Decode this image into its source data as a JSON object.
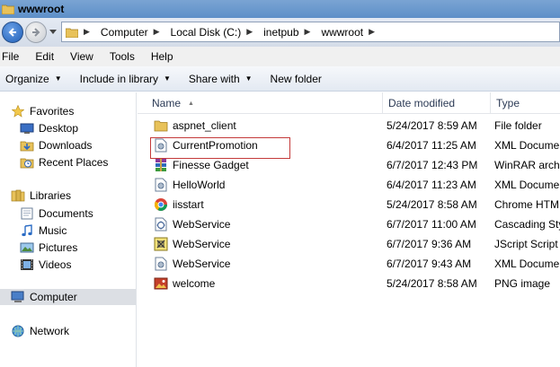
{
  "window": {
    "title": "wwwroot"
  },
  "address": {
    "crumbs": [
      {
        "label": "Computer"
      },
      {
        "label": "Local Disk (C:)"
      },
      {
        "label": "inetpub"
      },
      {
        "label": "wwwroot"
      }
    ]
  },
  "menu": {
    "items": [
      "File",
      "Edit",
      "View",
      "Tools",
      "Help"
    ]
  },
  "commands": {
    "organize": "Organize",
    "include": "Include in library",
    "share": "Share with",
    "newfolder": "New folder"
  },
  "navpane": {
    "favorites": "Favorites",
    "desktop": "Desktop",
    "downloads": "Downloads",
    "recent": "Recent Places",
    "libraries": "Libraries",
    "documents": "Documents",
    "music": "Music",
    "pictures": "Pictures",
    "videos": "Videos",
    "computer": "Computer",
    "network": "Network"
  },
  "columns": {
    "name": "Name",
    "date": "Date modified",
    "type": "Type"
  },
  "files": [
    {
      "name": "aspnet_client",
      "date": "5/24/2017 8:59 AM",
      "type": "File folder",
      "icon": "folder-icon"
    },
    {
      "name": "CurrentPromotion",
      "date": "6/4/2017 11:25 AM",
      "type": "XML Document",
      "icon": "xml-file-icon"
    },
    {
      "name": "Finesse Gadget",
      "date": "6/7/2017 12:43 PM",
      "type": "WinRAR archive",
      "icon": "winrar-file-icon"
    },
    {
      "name": "HelloWorld",
      "date": "6/4/2017 11:23 AM",
      "type": "XML Document",
      "icon": "xml-file-icon"
    },
    {
      "name": "iisstart",
      "date": "5/24/2017 8:58 AM",
      "type": "Chrome HTML Document",
      "icon": "chrome-file-icon"
    },
    {
      "name": "WebService",
      "date": "6/7/2017 11:00 AM",
      "type": "Cascading Style Sheet",
      "icon": "css-file-icon"
    },
    {
      "name": "WebService",
      "date": "6/7/2017 9:36 AM",
      "type": "JScript Script File",
      "icon": "js-file-icon"
    },
    {
      "name": "WebService",
      "date": "6/7/2017 9:43 AM",
      "type": "XML Document",
      "icon": "xml-file-icon"
    },
    {
      "name": "welcome",
      "date": "5/24/2017 8:58 AM",
      "type": "PNG image",
      "icon": "png-file-icon"
    }
  ],
  "colors": {
    "highlight_border": "#c43a3a",
    "titlebar": "#6b9ad0"
  }
}
